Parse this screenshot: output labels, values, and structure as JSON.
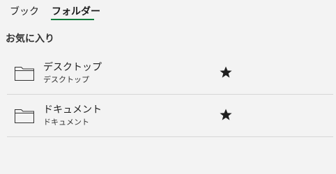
{
  "tabs": [
    {
      "label": "ブック",
      "active": false
    },
    {
      "label": "フォルダー",
      "active": true
    }
  ],
  "accent_color": "#0f7b3a",
  "favorites": {
    "title": "お気に入り",
    "items": [
      {
        "name": "デスクトップ",
        "path": "デスクトップ",
        "icon": "folder-icon",
        "pinned_icon": "star-icon"
      },
      {
        "name": "ドキュメント",
        "path": "ドキュメント",
        "icon": "folder-icon",
        "pinned_icon": "star-icon"
      }
    ]
  }
}
